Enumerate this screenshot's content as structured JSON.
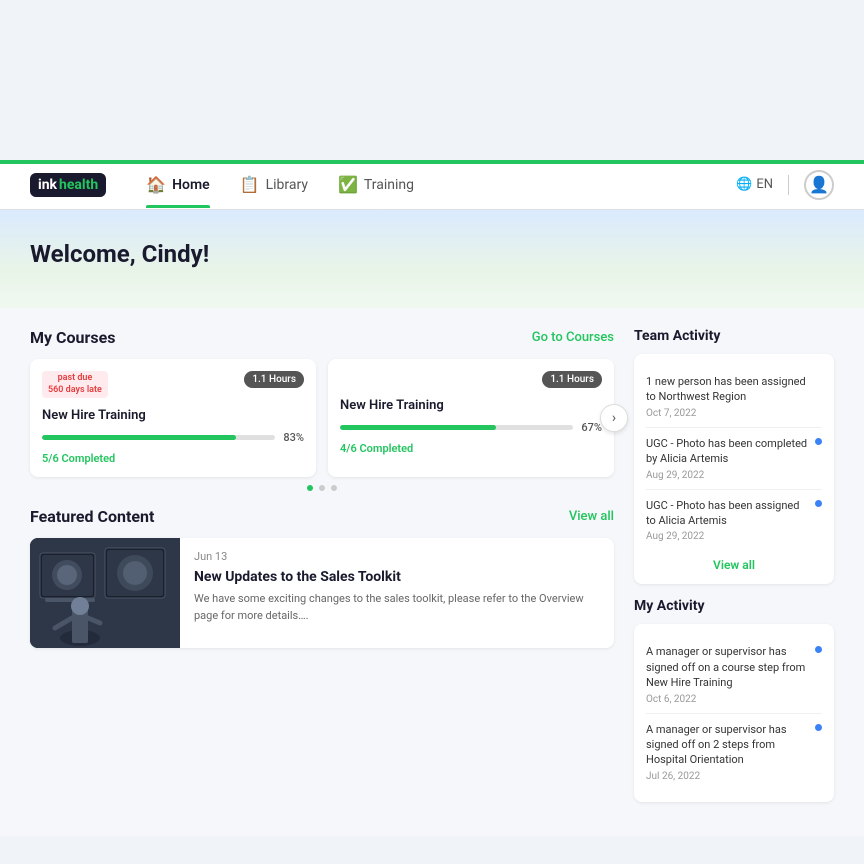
{
  "app": {
    "logo_ink": "ink",
    "logo_health": "health"
  },
  "nav": {
    "items": [
      {
        "label": "Home",
        "icon": "🏠",
        "active": true
      },
      {
        "label": "Library",
        "icon": "📋",
        "active": false
      },
      {
        "label": "Training",
        "icon": "✅",
        "active": false
      }
    ],
    "lang": "EN",
    "active_underline_color": "#22c55e"
  },
  "hero": {
    "greeting": "Welcome, Cindy!"
  },
  "my_courses": {
    "title": "My Courses",
    "link": "Go to Courses",
    "cards": [
      {
        "past_due": true,
        "past_due_line1": "past due",
        "past_due_line2": "560 days late",
        "hours": "1.1 Hours",
        "title": "New Hire Training",
        "progress_pct": 83,
        "progress_label": "83%",
        "completed": "5/6 Completed"
      },
      {
        "past_due": false,
        "hours": "1.1 Hours",
        "title": "New Hire Training",
        "progress_pct": 67,
        "progress_label": "67%",
        "completed": "4/6 Completed"
      }
    ],
    "next_btn_icon": "›",
    "dots": [
      true,
      false,
      false
    ]
  },
  "featured": {
    "title": "Featured Content",
    "link": "View all",
    "item": {
      "date": "Jun 13",
      "title": "New Updates to the Sales Toolkit",
      "description": "We have some exciting changes to the sales toolkit, please refer to the Overview page for more details…."
    }
  },
  "team_activity": {
    "title": "Team Activity",
    "items": [
      {
        "text": "1 new person has been assigned to Northwest Region",
        "date": "Oct 7, 2022",
        "has_dot": false
      },
      {
        "text": "UGC - Photo has been completed by Alicia Artemis",
        "date": "Aug 29, 2022",
        "has_dot": true
      },
      {
        "text": "UGC - Photo has been assigned to Alicia Artemis",
        "date": "Aug 29, 2022",
        "has_dot": true
      }
    ],
    "view_all": "View all"
  },
  "my_activity": {
    "title": "My Activity",
    "items": [
      {
        "text": "A manager or supervisor has signed off on a course step from New Hire Training",
        "date": "Oct 6, 2022",
        "has_dot": true
      },
      {
        "text": "A manager or supervisor has signed off on 2 steps from Hospital Orientation",
        "date": "Jul 26, 2022",
        "has_dot": true
      }
    ]
  }
}
